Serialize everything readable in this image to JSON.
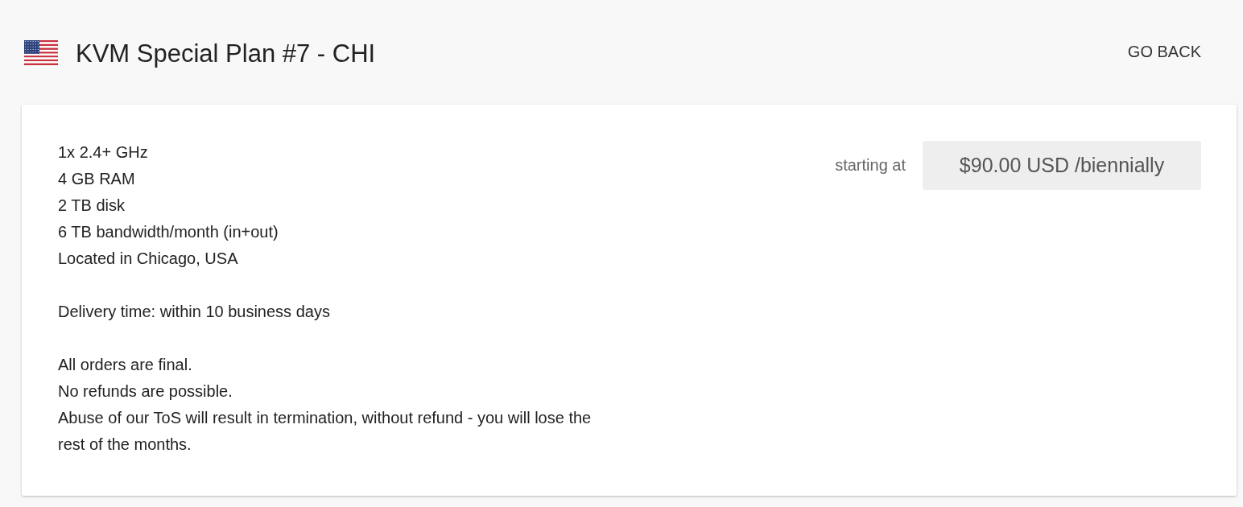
{
  "header": {
    "title": "KVM Special Plan #7 - CHI",
    "back_button": "GO BACK"
  },
  "plan": {
    "paragraphs": [
      [
        "1x 2.4+ GHz",
        "4 GB RAM",
        "2 TB disk",
        "6 TB bandwidth/month (in+out)",
        "Located in Chicago, USA"
      ],
      [
        "Delivery time: within 10 business days"
      ],
      [
        "All orders are final.",
        "No refunds are possible.",
        "Abuse of our ToS will result in termination, without refund - you will lose the rest of the months."
      ]
    ],
    "price_label": "starting at",
    "price": "$90.00 USD /biennially"
  }
}
